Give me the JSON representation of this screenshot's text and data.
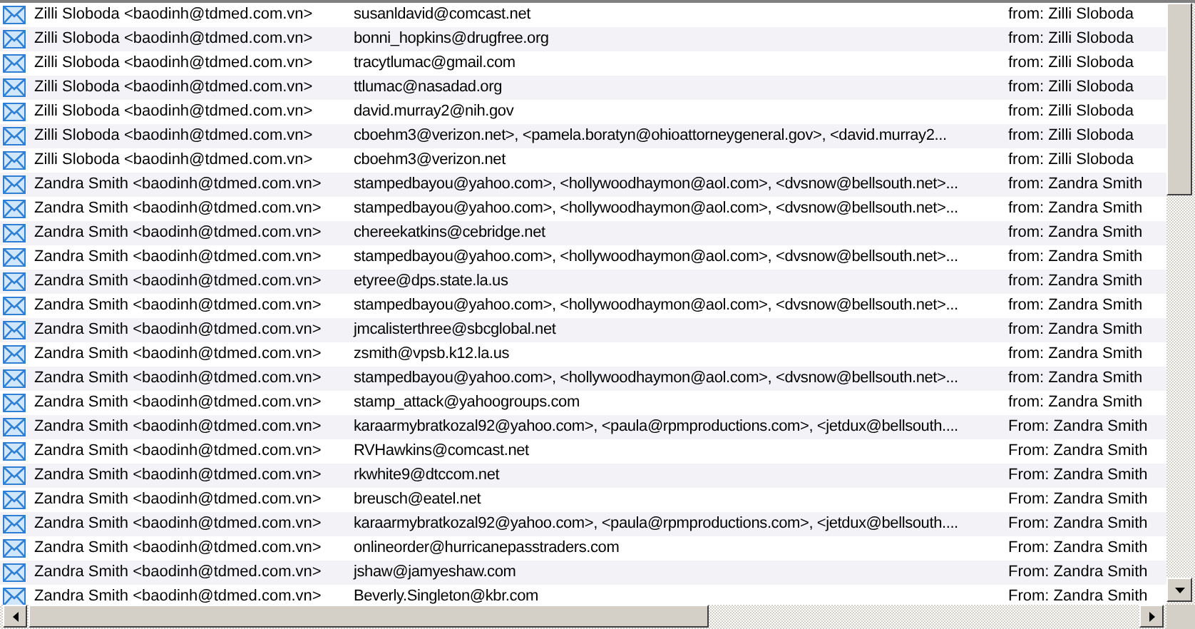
{
  "messages": [
    {
      "from": "Zilli Sloboda <baodinh@tdmed.com.vn>",
      "to": "susanldavid@comcast.net",
      "subject": "from: Zilli Sloboda"
    },
    {
      "from": "Zilli Sloboda <baodinh@tdmed.com.vn>",
      "to": "bonni_hopkins@drugfree.org",
      "subject": "from: Zilli Sloboda"
    },
    {
      "from": "Zilli Sloboda <baodinh@tdmed.com.vn>",
      "to": "tracytlumac@gmail.com",
      "subject": "from: Zilli Sloboda"
    },
    {
      "from": "Zilli Sloboda <baodinh@tdmed.com.vn>",
      "to": "ttlumac@nasadad.org",
      "subject": "from: Zilli Sloboda"
    },
    {
      "from": "Zilli Sloboda <baodinh@tdmed.com.vn>",
      "to": "david.murray2@nih.gov",
      "subject": "from: Zilli Sloboda"
    },
    {
      "from": "Zilli Sloboda <baodinh@tdmed.com.vn>",
      "to": "cboehm3@verizon.net>, <pamela.boratyn@ohioattorneygeneral.gov>, <david.murray2...",
      "subject": "from: Zilli Sloboda"
    },
    {
      "from": "Zilli Sloboda <baodinh@tdmed.com.vn>",
      "to": "cboehm3@verizon.net",
      "subject": "from: Zilli Sloboda"
    },
    {
      "from": "Zandra Smith <baodinh@tdmed.com.vn>",
      "to": "stampedbayou@yahoo.com>, <hollywoodhaymon@aol.com>, <dvsnow@bellsouth.net>...",
      "subject": "from: Zandra Smith"
    },
    {
      "from": "Zandra Smith <baodinh@tdmed.com.vn>",
      "to": "stampedbayou@yahoo.com>, <hollywoodhaymon@aol.com>, <dvsnow@bellsouth.net>...",
      "subject": "from: Zandra Smith"
    },
    {
      "from": "Zandra Smith <baodinh@tdmed.com.vn>",
      "to": "chereekatkins@cebridge.net",
      "subject": "from: Zandra Smith"
    },
    {
      "from": "Zandra Smith <baodinh@tdmed.com.vn>",
      "to": "stampedbayou@yahoo.com>, <hollywoodhaymon@aol.com>, <dvsnow@bellsouth.net>...",
      "subject": "from: Zandra Smith"
    },
    {
      "from": "Zandra Smith <baodinh@tdmed.com.vn>",
      "to": "etyree@dps.state.la.us",
      "subject": "from: Zandra Smith"
    },
    {
      "from": "Zandra Smith <baodinh@tdmed.com.vn>",
      "to": "stampedbayou@yahoo.com>, <hollywoodhaymon@aol.com>, <dvsnow@bellsouth.net>...",
      "subject": "from: Zandra Smith"
    },
    {
      "from": "Zandra Smith <baodinh@tdmed.com.vn>",
      "to": "jmcalisterthree@sbcglobal.net",
      "subject": "from: Zandra Smith"
    },
    {
      "from": "Zandra Smith <baodinh@tdmed.com.vn>",
      "to": "zsmith@vpsb.k12.la.us",
      "subject": "from: Zandra Smith"
    },
    {
      "from": "Zandra Smith <baodinh@tdmed.com.vn>",
      "to": "stampedbayou@yahoo.com>, <hollywoodhaymon@aol.com>, <dvsnow@bellsouth.net>...",
      "subject": "from: Zandra Smith"
    },
    {
      "from": "Zandra Smith <baodinh@tdmed.com.vn>",
      "to": "stamp_attack@yahoogroups.com",
      "subject": "from: Zandra Smith"
    },
    {
      "from": "Zandra Smith <baodinh@tdmed.com.vn>",
      "to": "karaarmybratkozal92@yahoo.com>, <paula@rpmproductions.com>, <jetdux@bellsouth....",
      "subject": "From: Zandra Smith"
    },
    {
      "from": "Zandra Smith <baodinh@tdmed.com.vn>",
      "to": "RVHawkins@comcast.net",
      "subject": "From: Zandra Smith"
    },
    {
      "from": "Zandra Smith <baodinh@tdmed.com.vn>",
      "to": "rkwhite9@dtccom.net",
      "subject": "From: Zandra Smith"
    },
    {
      "from": "Zandra Smith <baodinh@tdmed.com.vn>",
      "to": "breusch@eatel.net",
      "subject": "From: Zandra Smith"
    },
    {
      "from": "Zandra Smith <baodinh@tdmed.com.vn>",
      "to": "karaarmybratkozal92@yahoo.com>, <paula@rpmproductions.com>, <jetdux@bellsouth....",
      "subject": "From: Zandra Smith"
    },
    {
      "from": "Zandra Smith <baodinh@tdmed.com.vn>",
      "to": "onlineorder@hurricanepasstraders.com",
      "subject": "From: Zandra Smith"
    },
    {
      "from": "Zandra Smith <baodinh@tdmed.com.vn>",
      "to": "jshaw@jamyeshaw.com",
      "subject": "From: Zandra Smith"
    },
    {
      "from": "Zandra Smith <baodinh@tdmed.com.vn>",
      "to": "Beverly.Singleton@kbr.com",
      "subject": "From: Zandra Smith"
    }
  ]
}
